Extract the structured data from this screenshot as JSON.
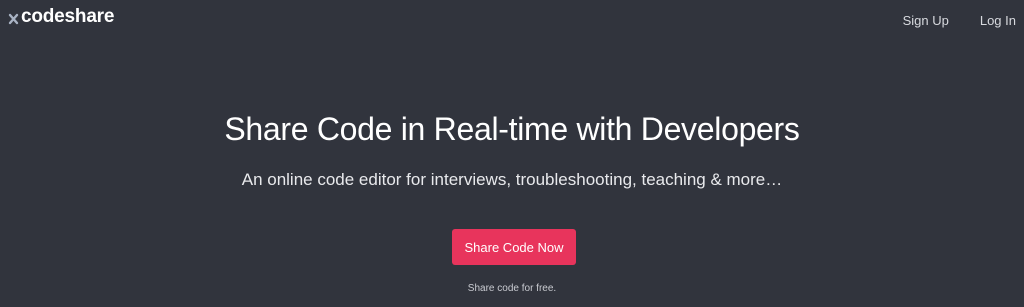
{
  "header": {
    "logo_text": "codeshare",
    "nav": [
      {
        "label": "Sign Up"
      },
      {
        "label": "Log In"
      }
    ]
  },
  "hero": {
    "title": "Share Code in Real-time with Developers",
    "subtitle": "An online code editor for interviews, troubleshooting, teaching & more…",
    "cta_label": "Share Code Now",
    "note": "Share code for free."
  },
  "colors": {
    "background": "#31343d",
    "accent": "#e8345c",
    "logo_x": "#a9b3c4"
  },
  "icons": {
    "logo_mark": "x-logo-icon"
  }
}
